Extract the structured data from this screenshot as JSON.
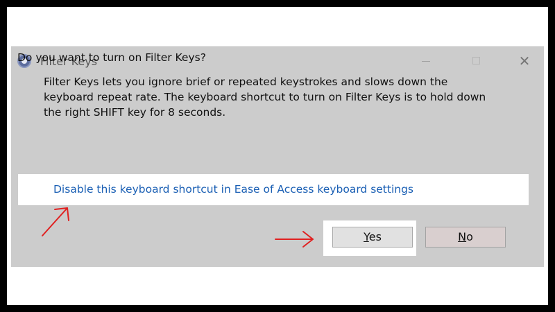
{
  "dialog": {
    "title": "Filter Keys",
    "question": "Do you want to turn on Filter Keys?",
    "description_lines": [
      "Filter Keys lets you ignore brief or repeated keystrokes and slows down the",
      "keyboard repeat rate.  The keyboard shortcut to turn on Filter Keys is to hold down",
      "the right SHIFT key for 8 seconds."
    ],
    "link_text": "Disable this keyboard shortcut in Ease of Access keyboard settings",
    "yes_mnemonic": "Y",
    "yes_rest": "es",
    "no_mnemonic": "N",
    "no_rest": "o",
    "close_glyph": "✕"
  },
  "icons": {
    "app": "accessibility-icon",
    "minimize": "minimize-icon",
    "maximize": "maximize-icon",
    "close": "close-icon"
  },
  "colors": {
    "dialog_bg": "#cccccc",
    "link": "#1a5fb4",
    "annotation_arrow": "#e02020"
  }
}
